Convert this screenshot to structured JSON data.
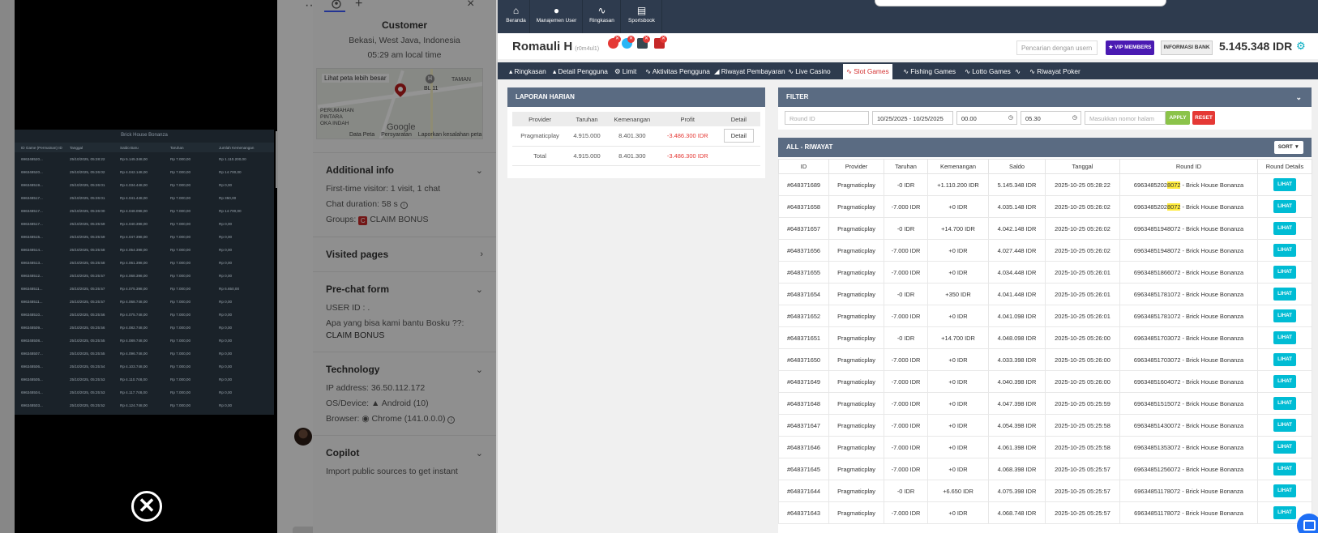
{
  "chat_panel": {
    "customer_title": "Customer",
    "location": "Bekasi, West Java, Indonesia",
    "local_time": "05:29 am local time",
    "map": {
      "larger_map": "Lihat peta lebih besar",
      "label_taman": "TAMAN",
      "label_bl": "BL 11",
      "label_perumahan": "PERUMAHAN\nPINTARA\nOKA INDAH",
      "google": "Google",
      "footer_data": "Data Peta",
      "footer_terms": "Persyaratan",
      "footer_report": "Laporkan kesalahan peta"
    },
    "additional_info": {
      "title": "Additional info",
      "visitor": "First-time visitor: 1 visit, 1 chat",
      "duration": "Chat duration: 58 s",
      "groups_label": "Groups:",
      "groups_badge": "C",
      "groups_value": "CLAIM BONUS"
    },
    "visited_pages": {
      "title": "Visited pages"
    },
    "prechat": {
      "title": "Pre-chat form",
      "user_id": "USER ID : .",
      "question": "Apa yang bisa kami bantu Bosku ??:",
      "answer": "CLAIM BONUS"
    },
    "technology": {
      "title": "Technology",
      "ip": "IP address: 36.50.112.172",
      "os_label": "OS/Device:",
      "os_value": "Android (10)",
      "browser_label": "Browser:",
      "browser_value": "Chrome (141.0.0.0)"
    },
    "copilot": {
      "title": "Copilot",
      "desc": "Import public sources to get instant"
    }
  },
  "video_overlay": {
    "shot_title": "Brick House Bonanza",
    "shot_headers": [
      "ID Game (Permainan) ID",
      "Tanggal",
      "Saldo Baru",
      "Taruhan",
      "Jumlah Kemenangan"
    ],
    "shot_rows": [
      [
        "696348520...",
        "25/10/2025, 05:28:22",
        "Rp 5.145.348,00",
        "Rp 7.000,00",
        "Rp 1.110.200,00"
      ],
      [
        "696348520...",
        "25/10/2025, 05:26:02",
        "Rp 4.042.148,00",
        "Rp 7.000,00",
        "Rp 14.700,00"
      ],
      [
        "696348519...",
        "25/10/2025, 05:26:01",
        "Rp 4.034.448,00",
        "Rp 7.000,00",
        "Rp 0,00"
      ],
      [
        "696348517...",
        "25/10/2025, 05:26:01",
        "Rp 4.041.448,00",
        "Rp 7.000,00",
        "Rp 350,00"
      ],
      [
        "696348517...",
        "25/10/2025, 05:26:00",
        "Rp 4.048.098,00",
        "Rp 7.000,00",
        "Rp 14.700,00"
      ],
      [
        "696348517...",
        "25/10/2025, 05:25:59",
        "Rp 4.040.398,00",
        "Rp 7.000,00",
        "Rp 0,00"
      ],
      [
        "696348515...",
        "25/10/2025, 05:25:59",
        "Rp 4.047.398,00",
        "Rp 7.000,00",
        "Rp 0,00"
      ],
      [
        "696348514...",
        "25/10/2025, 05:25:58",
        "Rp 4.054.398,00",
        "Rp 7.000,00",
        "Rp 0,00"
      ],
      [
        "696348513...",
        "25/10/2025, 05:25:58",
        "Rp 4.061.398,00",
        "Rp 7.000,00",
        "Rp 0,00"
      ],
      [
        "696348512...",
        "25/10/2025, 05:25:57",
        "Rp 4.068.398,00",
        "Rp 7.000,00",
        "Rp 0,00"
      ],
      [
        "696348511...",
        "25/10/2025, 05:25:57",
        "Rp 4.075.398,00",
        "Rp 7.000,00",
        "Rp 6.650,00"
      ],
      [
        "696348511...",
        "25/10/2025, 05:25:57",
        "Rp 4.068.748,00",
        "Rp 7.000,00",
        "Rp 0,00"
      ],
      [
        "696348510...",
        "25/10/2025, 05:25:56",
        "Rp 4.075.748,00",
        "Rp 7.000,00",
        "Rp 0,00"
      ],
      [
        "696348509...",
        "25/10/2025, 05:25:56",
        "Rp 4.082.748,00",
        "Rp 7.000,00",
        "Rp 0,00"
      ],
      [
        "696348508...",
        "25/10/2025, 05:25:55",
        "Rp 4.089.748,00",
        "Rp 7.000,00",
        "Rp 0,00"
      ],
      [
        "696348507...",
        "25/10/2025, 05:25:55",
        "Rp 4.096.748,00",
        "Rp 7.000,00",
        "Rp 0,00"
      ],
      [
        "696348506...",
        "25/10/2025, 05:25:54",
        "Rp 4.103.748,00",
        "Rp 7.000,00",
        "Rp 0,00"
      ],
      [
        "696348505...",
        "25/10/2025, 05:25:53",
        "Rp 4.110.748,00",
        "Rp 7.000,00",
        "Rp 0,00"
      ],
      [
        "696348504...",
        "25/10/2025, 05:25:53",
        "Rp 4.117.748,00",
        "Rp 7.000,00",
        "Rp 0,00"
      ],
      [
        "696348503...",
        "25/10/2025, 05:25:52",
        "Rp 4.124.748,00",
        "Rp 7.000,00",
        "Rp 0,00"
      ]
    ],
    "close_glyph": "✕"
  },
  "admin": {
    "topnav": [
      {
        "label": "Beranda",
        "icon": "⌂"
      },
      {
        "label": "Manajemen User",
        "icon": "●"
      },
      {
        "label": "Ringkasan",
        "icon": "∿"
      },
      {
        "label": "Sportsbook",
        "icon": "▤"
      }
    ],
    "user": {
      "name": "Romauli H",
      "username": "(r0m4ul1)",
      "search_placeholder": "Pencarian dengan usern",
      "vip_label": "VIP MEMBERS",
      "bank_label": "INFORMASI BANK",
      "balance": "5.145.348 IDR",
      "icon_colors": [
        "#e53935",
        "#29b6f6",
        "#37474f",
        "#c62828"
      ]
    },
    "tabs": [
      {
        "label": "Ringkasan",
        "icon": "👤"
      },
      {
        "label": "Detail Pengguna",
        "icon": "👤"
      },
      {
        "label": "Limit",
        "icon": "⚙"
      },
      {
        "label": "Aktivitas Pengguna",
        "icon": "∿"
      },
      {
        "label": "Riwayat Pembayaran",
        "icon": "◢"
      },
      {
        "label": "Live Casino",
        "icon": "∿"
      },
      {
        "label": "Slot Games",
        "icon": "∿"
      },
      {
        "label": "Fishing Games",
        "icon": "∿"
      },
      {
        "label": "Lotto Games",
        "icon": "∿"
      },
      {
        "label": "",
        "icon": "∿"
      },
      {
        "label": "Riwayat Poker",
        "icon": "∿"
      }
    ],
    "laporan": {
      "title": "LAPORAN HARIAN",
      "headers": [
        "Provider",
        "Taruhan",
        "Kemenangan",
        "Profit",
        "Detail"
      ],
      "row": [
        "Pragmaticplay",
        "4.915.000",
        "8.401.300",
        "-3.486.300 IDR"
      ],
      "detail_label": "Detail",
      "total": [
        "Total",
        "4.915.000",
        "8.401.300",
        "-3.486.300 IDR"
      ]
    },
    "filter": {
      "title": "FILTER",
      "round_placeholder": "Round ID",
      "date_range": "10/25/2025 - 10/25/2025",
      "time_from": "00.00",
      "time_to": "05.30",
      "page_placeholder": "Masukkan nomor halam",
      "apply_label": "APPLY",
      "reset_label": "RESET"
    },
    "history": {
      "title": "ALL - RIWAYAT",
      "sort_label": "SORT",
      "headers": [
        "ID",
        "Provider",
        "Taruhan",
        "Kemenangan",
        "Saldo",
        "Tanggal",
        "Round ID",
        "Round Details"
      ],
      "button_label": "LIHAT",
      "rows": [
        {
          "id": "#648371689",
          "provider": "Pragmaticplay",
          "bet": "-0 IDR",
          "win": "+1.110.200 IDR",
          "saldo": "5.145.348 IDR",
          "date": "2025-10-25 05:28:22",
          "round_pre": "6963485202",
          "round_hl": "8072",
          "round_post": " - Brick House Bonanza"
        },
        {
          "id": "#648371658",
          "provider": "Pragmaticplay",
          "bet": "-7.000 IDR",
          "win": "+0 IDR",
          "saldo": "4.035.148 IDR",
          "date": "2025-10-25 05:26:02",
          "round_pre": "6963485202",
          "round_hl": "8072",
          "round_post": " - Brick House Bonanza"
        },
        {
          "id": "#648371657",
          "provider": "Pragmaticplay",
          "bet": "-0 IDR",
          "win": "+14.700 IDR",
          "saldo": "4.042.148 IDR",
          "date": "2025-10-25 05:26:02",
          "round_pre": "69634851948072",
          "round_hl": "",
          "round_post": " - Brick House Bonanza"
        },
        {
          "id": "#648371656",
          "provider": "Pragmaticplay",
          "bet": "-7.000 IDR",
          "win": "+0 IDR",
          "saldo": "4.027.448 IDR",
          "date": "2025-10-25 05:26:02",
          "round_pre": "69634851948072",
          "round_hl": "",
          "round_post": " - Brick House Bonanza"
        },
        {
          "id": "#648371655",
          "provider": "Pragmaticplay",
          "bet": "-7.000 IDR",
          "win": "+0 IDR",
          "saldo": "4.034.448 IDR",
          "date": "2025-10-25 05:26:01",
          "round_pre": "69634851866072",
          "round_hl": "",
          "round_post": " - Brick House Bonanza"
        },
        {
          "id": "#648371654",
          "provider": "Pragmaticplay",
          "bet": "-0 IDR",
          "win": "+350 IDR",
          "saldo": "4.041.448 IDR",
          "date": "2025-10-25 05:26:01",
          "round_pre": "69634851781072",
          "round_hl": "",
          "round_post": " - Brick House Bonanza"
        },
        {
          "id": "#648371652",
          "provider": "Pragmaticplay",
          "bet": "-7.000 IDR",
          "win": "+0 IDR",
          "saldo": "4.041.098 IDR",
          "date": "2025-10-25 05:26:01",
          "round_pre": "69634851781072",
          "round_hl": "",
          "round_post": " - Brick House Bonanza"
        },
        {
          "id": "#648371651",
          "provider": "Pragmaticplay",
          "bet": "-0 IDR",
          "win": "+14.700 IDR",
          "saldo": "4.048.098 IDR",
          "date": "2025-10-25 05:26:00",
          "round_pre": "69634851703072",
          "round_hl": "",
          "round_post": " - Brick House Bonanza"
        },
        {
          "id": "#648371650",
          "provider": "Pragmaticplay",
          "bet": "-7.000 IDR",
          "win": "+0 IDR",
          "saldo": "4.033.398 IDR",
          "date": "2025-10-25 05:26:00",
          "round_pre": "69634851703072",
          "round_hl": "",
          "round_post": " - Brick House Bonanza"
        },
        {
          "id": "#648371649",
          "provider": "Pragmaticplay",
          "bet": "-7.000 IDR",
          "win": "+0 IDR",
          "saldo": "4.040.398 IDR",
          "date": "2025-10-25 05:26:00",
          "round_pre": "69634851604072",
          "round_hl": "",
          "round_post": " - Brick House Bonanza"
        },
        {
          "id": "#648371648",
          "provider": "Pragmaticplay",
          "bet": "-7.000 IDR",
          "win": "+0 IDR",
          "saldo": "4.047.398 IDR",
          "date": "2025-10-25 05:25:59",
          "round_pre": "69634851515072",
          "round_hl": "",
          "round_post": " - Brick House Bonanza"
        },
        {
          "id": "#648371647",
          "provider": "Pragmaticplay",
          "bet": "-7.000 IDR",
          "win": "+0 IDR",
          "saldo": "4.054.398 IDR",
          "date": "2025-10-25 05:25:58",
          "round_pre": "69634851430072",
          "round_hl": "",
          "round_post": " - Brick House Bonanza"
        },
        {
          "id": "#648371646",
          "provider": "Pragmaticplay",
          "bet": "-7.000 IDR",
          "win": "+0 IDR",
          "saldo": "4.061.398 IDR",
          "date": "2025-10-25 05:25:58",
          "round_pre": "69634851353072",
          "round_hl": "",
          "round_post": " - Brick House Bonanza"
        },
        {
          "id": "#648371645",
          "provider": "Pragmaticplay",
          "bet": "-7.000 IDR",
          "win": "+0 IDR",
          "saldo": "4.068.398 IDR",
          "date": "2025-10-25 05:25:57",
          "round_pre": "69634851256072",
          "round_hl": "",
          "round_post": " - Brick House Bonanza"
        },
        {
          "id": "#648371644",
          "provider": "Pragmaticplay",
          "bet": "-0 IDR",
          "win": "+6.650 IDR",
          "saldo": "4.075.398 IDR",
          "date": "2025-10-25 05:25:57",
          "round_pre": "69634851178072",
          "round_hl": "",
          "round_post": " - Brick House Bonanza"
        },
        {
          "id": "#648371643",
          "provider": "Pragmaticplay",
          "bet": "-7.000 IDR",
          "win": "+0 IDR",
          "saldo": "4.068.748 IDR",
          "date": "2025-10-25 05:25:57",
          "round_pre": "69634851178072",
          "round_hl": "",
          "round_post": " - Brick House Bonanza"
        }
      ]
    }
  }
}
